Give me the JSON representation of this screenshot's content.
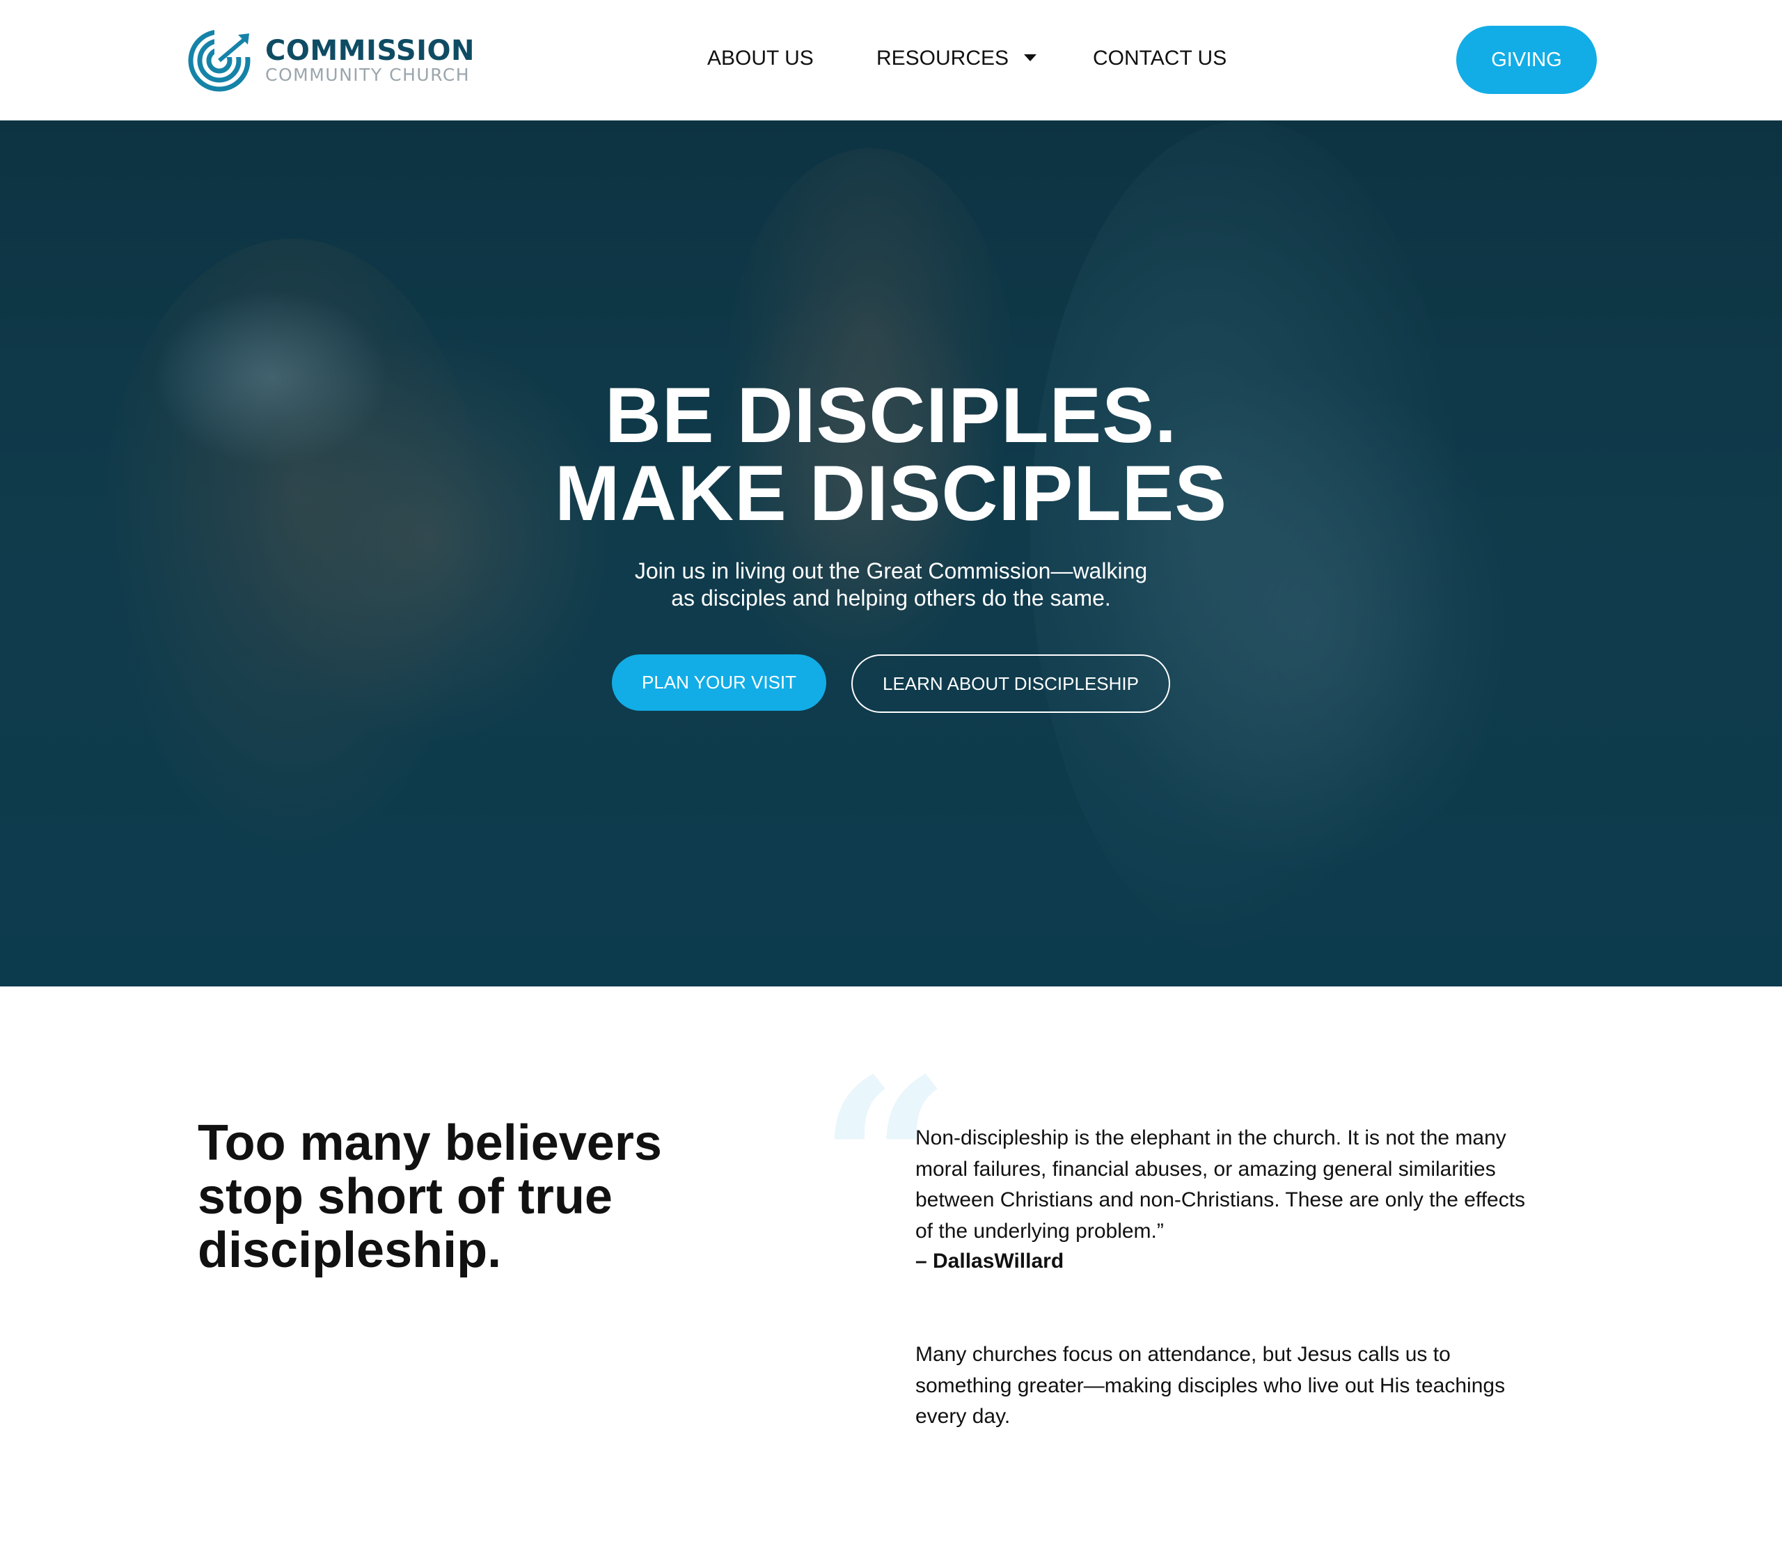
{
  "header": {
    "logo": {
      "icon": "target-icon",
      "name": "COMMISSION",
      "subtitle": "COMMUNITY CHURCH"
    },
    "nav": {
      "about": "ABOUT US",
      "resources": "RESOURCES",
      "contact": "CONTACT US"
    },
    "giving_label": "GIVING"
  },
  "hero": {
    "title_line1": "BE DISCIPLES.",
    "title_line2": "MAKE DISCIPLES",
    "subtitle_line1": "Join us in living out the Great Commission—walking",
    "subtitle_line2": "as disciples and helping others do the same.",
    "primary_button": "PLAN YOUR VISIT",
    "secondary_button": "LEARN ABOUT DISCIPLESHIP"
  },
  "intro": {
    "headline_line1": "Too many believers",
    "headline_line2": "stop short of true",
    "headline_line3": "discipleship.",
    "quote_mark": "“",
    "quote_line1": "Non-discipleship is the elephant in the church. It is not the many",
    "quote_line2": "moral failures, financial abuses, or amazing general similarities",
    "quote_line3": "between Christians and non-Christians. These are only the effects",
    "quote_line4": "of the underlying problem.”",
    "quote_author": "– DallasWillard",
    "body_line1": "Many churches focus on attendance, but Jesus calls us to",
    "body_line2": "something greater—making disciples who live out His teachings",
    "body_line3": "every day."
  },
  "colors": {
    "accent": "#12ade6",
    "brand_dark": "#0f4c63",
    "hero_overlay": "#0c3444"
  }
}
